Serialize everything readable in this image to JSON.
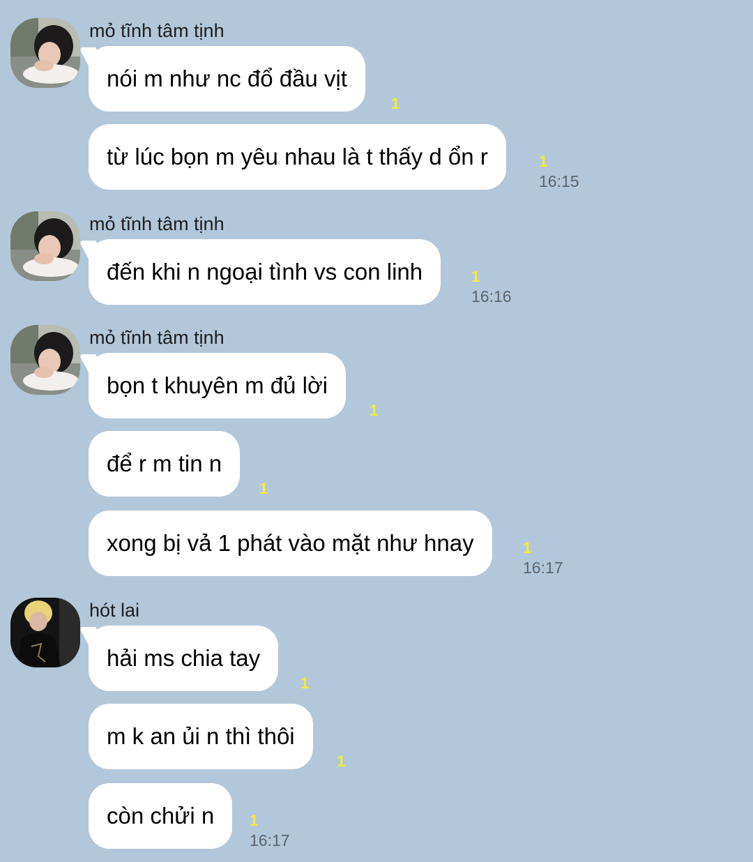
{
  "chat": {
    "groups": [
      {
        "sender": "mỏ tĩnh tâm tịnh",
        "avatar": "girl-photo-avatar",
        "messages": [
          {
            "text": "nói m như nc đổ đầu vịt",
            "unread": "1",
            "time": ""
          },
          {
            "text": "từ lúc bọn m yêu nhau là t thấy d ổn r",
            "unread": "1",
            "time": "16:15"
          }
        ]
      },
      {
        "sender": "mỏ tĩnh tâm tịnh",
        "avatar": "girl-photo-avatar",
        "messages": [
          {
            "text": "đến khi n ngoại tình vs con linh",
            "unread": "1",
            "time": "16:16"
          }
        ]
      },
      {
        "sender": "mỏ tĩnh tâm tịnh",
        "avatar": "girl-photo-avatar",
        "messages": [
          {
            "text": "bọn t khuyên m đủ lời",
            "unread": "1",
            "time": ""
          },
          {
            "text": "để r m tin n",
            "unread": "1",
            "time": ""
          },
          {
            "text": "xong bị vả 1 phát vào mặt như hnay",
            "unread": "1",
            "time": "16:17"
          }
        ]
      },
      {
        "sender": "hót lai",
        "avatar": "boy-photo-avatar",
        "messages": [
          {
            "text": "hải ms chia tay",
            "unread": "1",
            "time": ""
          },
          {
            "text": "m k an ủi n thì thôi",
            "unread": "1",
            "time": ""
          },
          {
            "text": "còn chửi n",
            "unread": "1",
            "time": "16:17"
          }
        ]
      }
    ]
  },
  "colors": {
    "background": "#b2c7da",
    "bubble": "#ffffff",
    "unread": "#f4ec3a",
    "time": "#5c6670"
  }
}
